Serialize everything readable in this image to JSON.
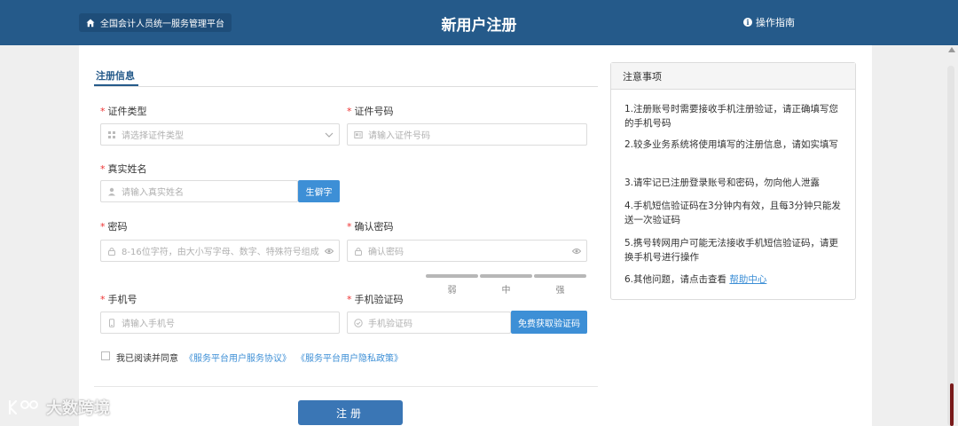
{
  "header": {
    "home_label": "全国会计人员统一服务管理平台",
    "title": "新用户注册",
    "guide_label": "操作指南"
  },
  "tab": {
    "label": "注册信息"
  },
  "form": {
    "required_mark": "*",
    "id_type": {
      "label": "证件类型",
      "placeholder": "请选择证件类型"
    },
    "id_number": {
      "label": "证件号码",
      "placeholder": "请输入证件号码"
    },
    "real_name": {
      "label": "真实姓名",
      "placeholder": "请输入真实姓名",
      "button": "生僻字"
    },
    "password": {
      "label": "密码",
      "placeholder": "8-16位字符，由大小写字母、数字、特殊符号组成"
    },
    "confirm_password": {
      "label": "确认密码",
      "placeholder": "确认密码"
    },
    "strength": {
      "weak": "弱",
      "medium": "中",
      "strong": "强"
    },
    "phone": {
      "label": "手机号",
      "placeholder": "请输入手机号"
    },
    "sms_code": {
      "label": "手机验证码",
      "placeholder": "手机验证码",
      "button": "免费获取验证码"
    },
    "agree_text": "我已阅读并同意",
    "agreement_link": "《服务平台用户服务协议》",
    "privacy_link": "《服务平台用户隐私政策》",
    "submit": "注册"
  },
  "notice": {
    "title": "注意事项",
    "items": [
      "1.注册账号时需要接收手机注册验证，请正确填写您的手机号码",
      "2.较多业务系统将使用填写的注册信息，请如实填写",
      "3.请牢记已注册登录账号和密码，勿向他人泄露",
      "4.手机短信验证码在3分钟内有效，且每3分钟只能发送一次验证码",
      "5.携号转网用户可能无法接收手机短信验证码，请更换手机号进行操作"
    ],
    "item6_prefix": "6.其他问题，请点击查看 ",
    "help_link": "帮助中心"
  },
  "watermark": "大数跨境",
  "colors": {
    "header": "#255a8a",
    "accent": "#3d8fd6",
    "required": "#e33333"
  }
}
